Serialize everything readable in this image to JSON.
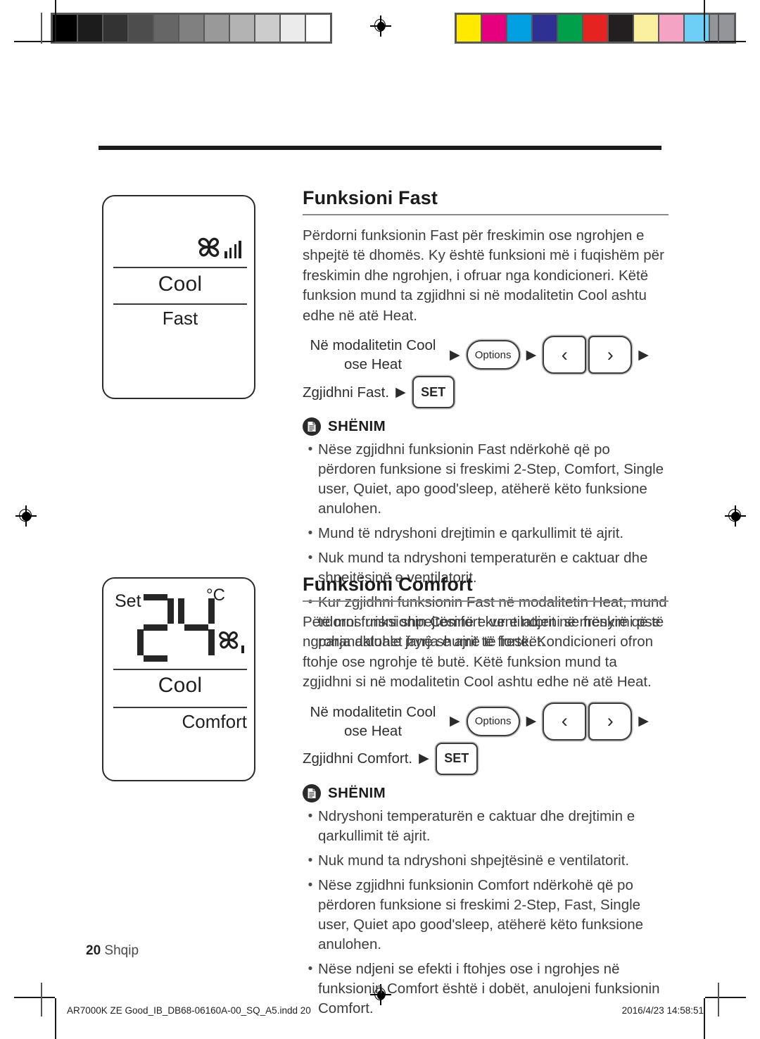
{
  "calibration": {
    "gray_ramp": [
      "#000000",
      "#1c1c1c",
      "#333333",
      "#4d4d4d",
      "#666666",
      "#808080",
      "#999999",
      "#b3b3b3",
      "#cccccc",
      "#ebebeb",
      "#ffffff"
    ],
    "color_ramp": [
      "#ffe900",
      "#e6007e",
      "#00a0e3",
      "#2e3192",
      "#00a04a",
      "#e52421",
      "#231f20",
      "#fbf0a0",
      "#f4a3c4",
      "#6ecff6",
      "#939598"
    ]
  },
  "displays": [
    {
      "name": "fast-display",
      "mode": "Cool",
      "function": "Fast",
      "fan_bars": 4
    },
    {
      "name": "comfort-display",
      "set_label": "Set",
      "temperature": "24",
      "unit": "°C",
      "mode": "Cool",
      "function": "Comfort",
      "fan_bars": 1
    }
  ],
  "sections": [
    {
      "title": "Funksioni Fast",
      "paragraph": "Përdorni funksionin Fast për freskimin ose ngrohjen e shpejtë të dhomës. Ky është funksioni më i fuqishëm për freskimin dhe ngrohjen, i ofruar nga kondicioneri. Këtë funksion mund ta zgjidhni si në modalitetin Cool ashtu edhe në atë Heat.",
      "steps": {
        "mode_label": "Në modalitetin Cool ose Heat",
        "options_button": "Options",
        "left_button": "‹",
        "right_button": "›",
        "select_label": "Zgjidhni Fast.",
        "set_button": "SET",
        "arrow": "▶"
      },
      "note": {
        "title": "SHËNIM",
        "items": [
          "Nëse zgjidhni funksionin Fast ndërkohë që po përdoren funksione si freskimi 2-Step, Comfort, Single user, Quiet, apo good'sleep, atëherë këto funksione anulohen.",
          "Mund të ndryshoni drejtimin e qarkullimit të ajrit.",
          "Nuk mund ta ndryshoni temperaturën e caktuar dhe shpejtësinë e ventilatorit.",
          "Kur zgjidhni funksionin Fast në modalitetin Heat, mund të mos rrisni shpejtësinë e ventilatorit në mënyrë që të parandalohet fryrja e ajrit të freskët."
        ]
      }
    },
    {
      "title": "Funksioni Comfort",
      "paragraph": "Përdorni funksionin Comfort kur e ndjeni se freskimi ose ngrohja aktuale janë shumë të fortë. Kondicioneri ofron ftohje ose ngrohje të butë. Këtë funksion mund ta zgjidhni si në modalitetin Cool ashtu edhe në atë Heat.",
      "steps": {
        "mode_label": "Në modalitetin Cool ose Heat",
        "options_button": "Options",
        "left_button": "‹",
        "right_button": "›",
        "select_label": "Zgjidhni Comfort.",
        "set_button": "SET",
        "arrow": "▶"
      },
      "note": {
        "title": "SHËNIM",
        "items": [
          "Ndryshoni temperaturën e caktuar dhe drejtimin e qarkullimit të ajrit.",
          "Nuk mund ta ndryshoni shpejtësinë e ventilatorit.",
          "Nëse zgjidhni funksionin Comfort ndërkohë që po përdoren funksione si freskimi 2-Step, Fast, Single user, Quiet apo good'sleep, atëherë këto funksione anulohen.",
          "Nëse ndjeni se efekti i ftohjes ose i ngrohjes në funksionin Comfort është i dobët, anulojeni funksionin Comfort."
        ]
      }
    }
  ],
  "footer": {
    "page_number": "20",
    "language": "Shqip",
    "print_file": "AR7000K ZE Good_IB_DB68-06160A-00_SQ_A5.indd   20",
    "print_timestamp": "2016/4/23   14:58:51"
  }
}
